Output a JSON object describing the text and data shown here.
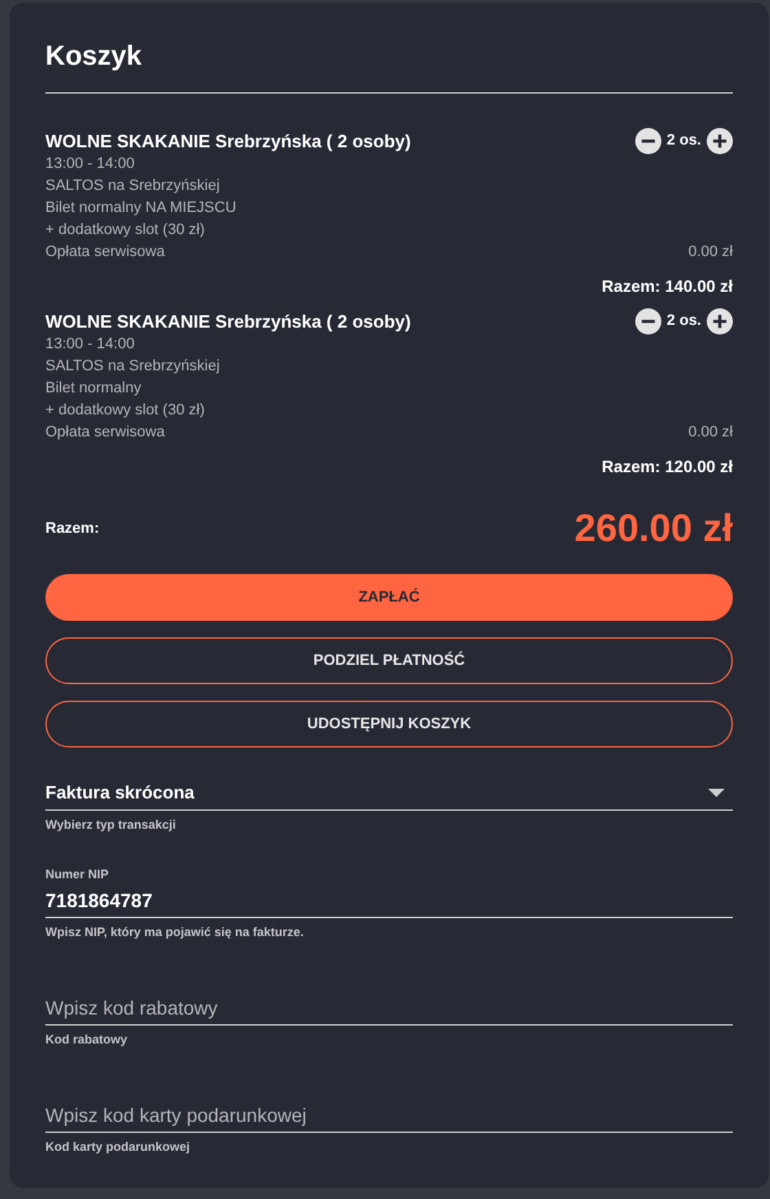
{
  "title": "Koszyk",
  "items": [
    {
      "name": "WOLNE SKAKANIE Srebrzyńska ( 2 osoby)",
      "quantity": "2 os.",
      "details": [
        "13:00 - 14:00",
        "SALTOS na Srebrzyńskiej",
        "Bilet normalny NA MIEJSCU",
        "+ dodatkowy slot (30 zł)"
      ],
      "fee_label": "Opłata serwisowa",
      "fee_value": "0.00 zł",
      "total": "Razem: 140.00 zł"
    },
    {
      "name": "WOLNE SKAKANIE Srebrzyńska ( 2 osoby)",
      "quantity": "2 os.",
      "details": [
        "13:00 - 14:00",
        "SALTOS na Srebrzyńskiej",
        "Bilet normalny",
        "+ dodatkowy slot (30 zł)"
      ],
      "fee_label": "Opłata serwisowa",
      "fee_value": "0.00 zł",
      "total": "Razem: 120.00 zł"
    }
  ],
  "summary": {
    "label": "Razem:",
    "amount": "260.00 zł"
  },
  "buttons": [
    {
      "label": "ZAPŁAĆ",
      "kind": "primary"
    },
    {
      "label": "PODZIEL PŁATNOŚĆ",
      "kind": "outline"
    },
    {
      "label": "UDOSTĘPNIJ KOSZYK",
      "kind": "outline"
    }
  ],
  "fields": [
    {
      "kind": "select",
      "value": "Faktura skrócona",
      "helper": "Wybierz typ transakcji"
    },
    {
      "kind": "input",
      "label": "Numer NIP",
      "value": "7181864787",
      "helper": "Wpisz NIP, który ma pojawić się na fakturze."
    },
    {
      "kind": "input",
      "placeholder": "Wpisz kod rabatowy",
      "helper": "Kod rabatowy"
    },
    {
      "kind": "input",
      "placeholder": "Wpisz kod karty podarunkowej",
      "helper": "Kod karty podarunkowej"
    }
  ]
}
